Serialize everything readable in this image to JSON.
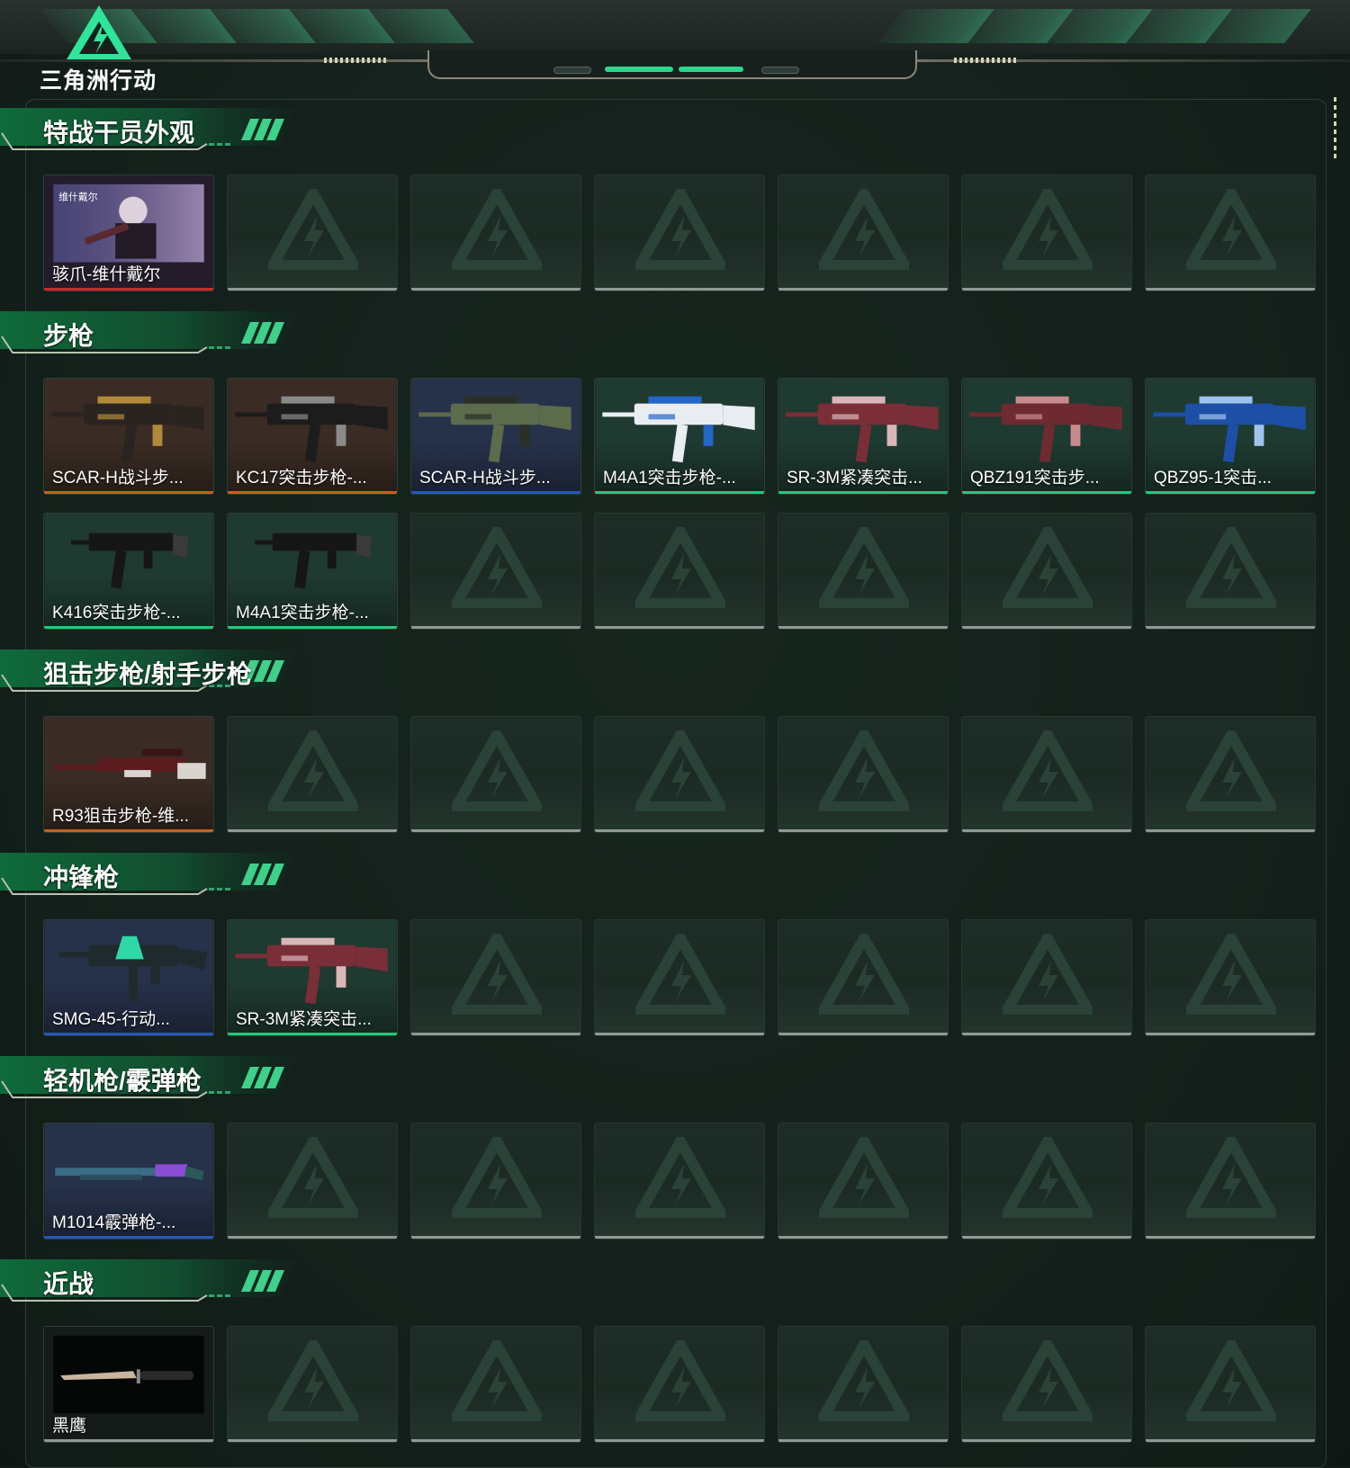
{
  "app": {
    "logo_text": "三角洲行动"
  },
  "colors": {
    "orange": "#c8601e",
    "blue": "#2557b8",
    "green": "#23c97a",
    "red": "#d1282e"
  },
  "sections": [
    {
      "title": "特战干员外观",
      "rows": [
        [
          {
            "name": "骇爪-维什戴尔",
            "quality": "red",
            "art": "operator",
            "tint": "#2b3556",
            "portrait_caption": "维什戴尔"
          },
          null,
          null,
          null,
          null,
          null,
          null
        ]
      ]
    },
    {
      "title": "步枪",
      "rows": [
        [
          {
            "name": "SCAR-H战斗步...",
            "quality": "orange",
            "art": "rifle-gold",
            "tint": "#3a2c24"
          },
          {
            "name": "KC17突击步枪-...",
            "quality": "orange",
            "art": "rifle-black",
            "tint": "#3a2c24"
          },
          {
            "name": "SCAR-H战斗步...",
            "quality": "blue",
            "art": "rifle-green",
            "tint": "#26314a"
          },
          {
            "name": "M4A1突击步枪-...",
            "quality": "green",
            "art": "rifle-white",
            "tint": "#1f3a30"
          },
          {
            "name": "SR-3M紧凑突击...",
            "quality": "green",
            "art": "rifle-pink",
            "tint": "#1f3a30"
          },
          {
            "name": "QBZ191突击步...",
            "quality": "green",
            "art": "rifle-pink2",
            "tint": "#1f3a30"
          },
          {
            "name": "QBZ95-1突击...",
            "quality": "green",
            "art": "rifle-blue",
            "tint": "#1f3a30"
          }
        ],
        [
          {
            "name": "K416突击步枪-...",
            "quality": "green",
            "art": "rifle-plain",
            "tint": "#1f3a30"
          },
          {
            "name": "M4A1突击步枪-...",
            "quality": "green",
            "art": "rifle-plain",
            "tint": "#1f3a30"
          },
          null,
          null,
          null,
          null,
          null
        ]
      ]
    },
    {
      "title": "狙击步枪/射手步枪",
      "rows": [
        [
          {
            "name": "R93狙击步枪-维...",
            "quality": "orange",
            "art": "sniper",
            "tint": "#3a2c24"
          },
          null,
          null,
          null,
          null,
          null,
          null
        ]
      ]
    },
    {
      "title": "冲锋枪",
      "rows": [
        [
          {
            "name": "SMG-45-行动...",
            "quality": "blue",
            "art": "smg-teal",
            "tint": "#26314a"
          },
          {
            "name": "SR-3M紧凑突击...",
            "quality": "green",
            "art": "rifle-pink",
            "tint": "#1f3a30"
          },
          null,
          null,
          null,
          null,
          null
        ]
      ]
    },
    {
      "title": "轻机枪/霰弹枪",
      "rows": [
        [
          {
            "name": "M1014霰弹枪-...",
            "quality": "blue",
            "art": "shotgun",
            "tint": "#26314a"
          },
          null,
          null,
          null,
          null,
          null,
          null
        ]
      ]
    },
    {
      "title": "近战",
      "rows": [
        [
          {
            "name": "黑鹰",
            "quality": "none",
            "art": "knife",
            "tint": "#1c2522"
          },
          null,
          null,
          null,
          null,
          null,
          null
        ]
      ]
    }
  ]
}
